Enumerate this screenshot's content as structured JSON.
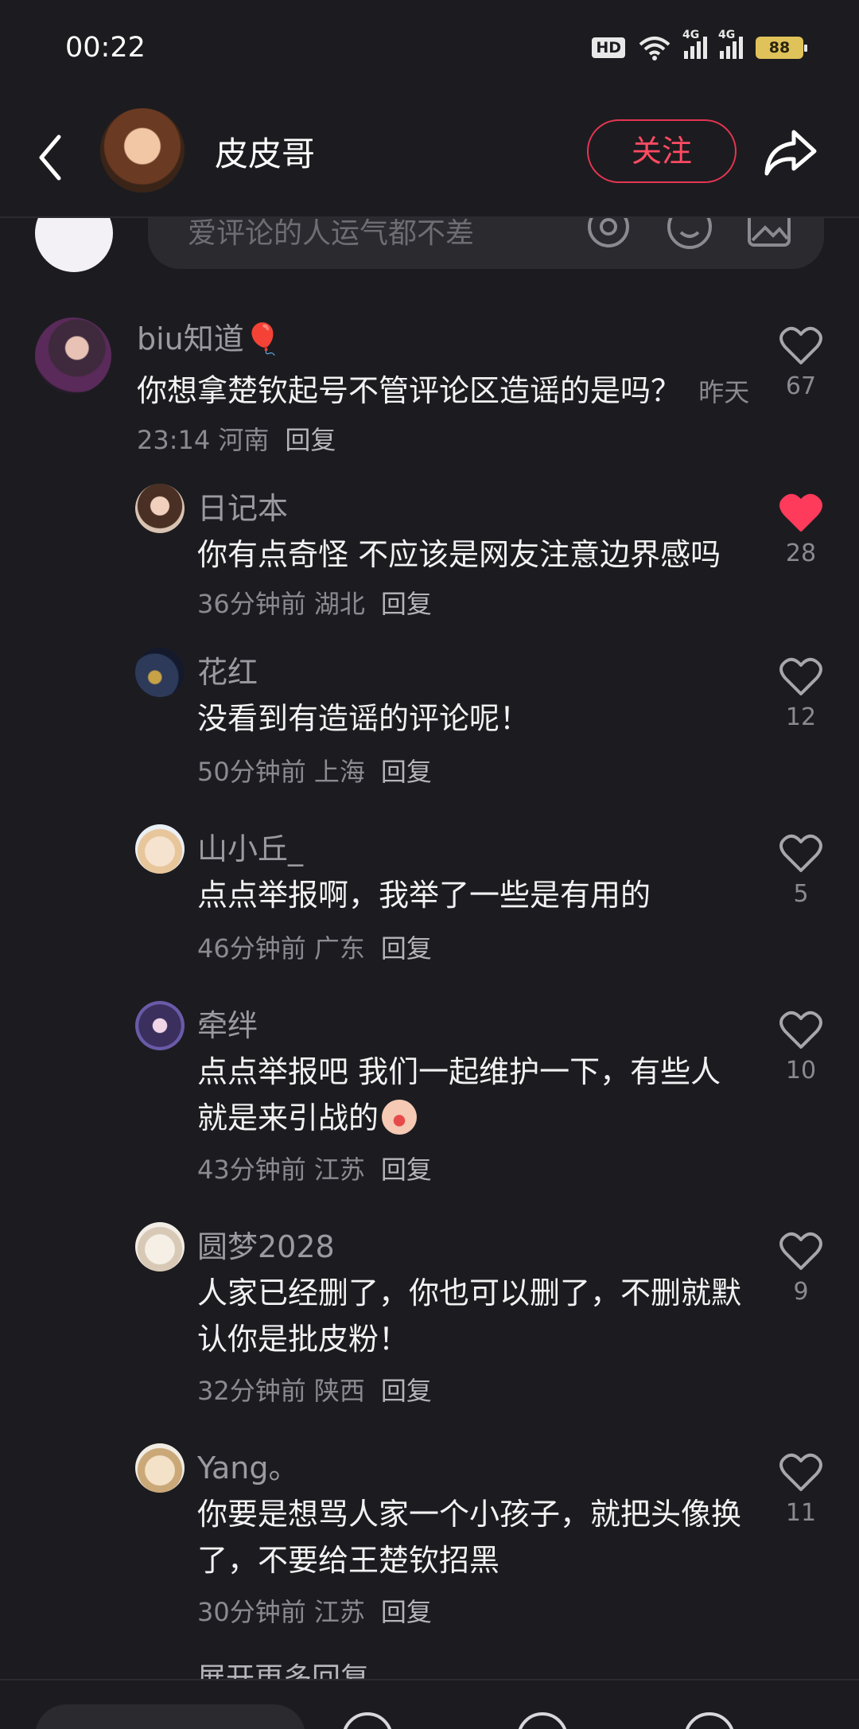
{
  "status_bar": {
    "time": "00:22",
    "hd": "HD",
    "net1": "4G",
    "net2": "4G",
    "battery": "88"
  },
  "header": {
    "username": "皮皮哥",
    "follow_label": "关注"
  },
  "composer": {
    "placeholder": "爱评论的人运气都不差"
  },
  "main_comment": {
    "name": "biu知道🎈",
    "text": "你想拿楚钦起号不管评论区造谣的是吗？",
    "meta": "昨天 23:14 河南",
    "reply_label": "回复",
    "likes": "67"
  },
  "replies": [
    {
      "name": "日记本",
      "text": "你有点奇怪 不应该是网友注意边界感吗",
      "meta": "36分钟前 湖北",
      "reply_label": "回复",
      "likes": "28",
      "liked": true
    },
    {
      "name": "花红",
      "text": "没看到有造谣的评论呢！",
      "meta": "50分钟前 上海",
      "reply_label": "回复",
      "likes": "12",
      "liked": false
    },
    {
      "name": "山小丘_",
      "text": "点点举报啊，我举了一些是有用的",
      "meta": "46分钟前 广东",
      "reply_label": "回复",
      "likes": "5",
      "liked": false
    },
    {
      "name": "牵绊",
      "text": "点点举报吧 我们一起维护一下，有些人就是来引战的",
      "meta": "43分钟前 江苏",
      "reply_label": "回复",
      "likes": "10",
      "liked": false
    },
    {
      "name": "圆梦2028",
      "text": "人家已经删了，你也可以删了，不删就默认你是批皮粉！",
      "meta": "32分钟前 陕西",
      "reply_label": "回复",
      "likes": "9",
      "liked": false
    },
    {
      "name": "Yang。",
      "text": "你要是想骂人家一个小孩子，就把头像换了，不要给王楚钦招黑",
      "meta": "30分钟前 江苏",
      "reply_label": "回复",
      "likes": "11",
      "liked": false
    }
  ],
  "expand_more": "展开更多回复",
  "colors": {
    "accent": "#e63552",
    "liked_heart": "#ff3b5c",
    "background": "#1c1c20"
  },
  "icons": [
    "back-icon",
    "share-icon",
    "at-icon",
    "emoji-icon",
    "image-icon",
    "heart-icon"
  ]
}
